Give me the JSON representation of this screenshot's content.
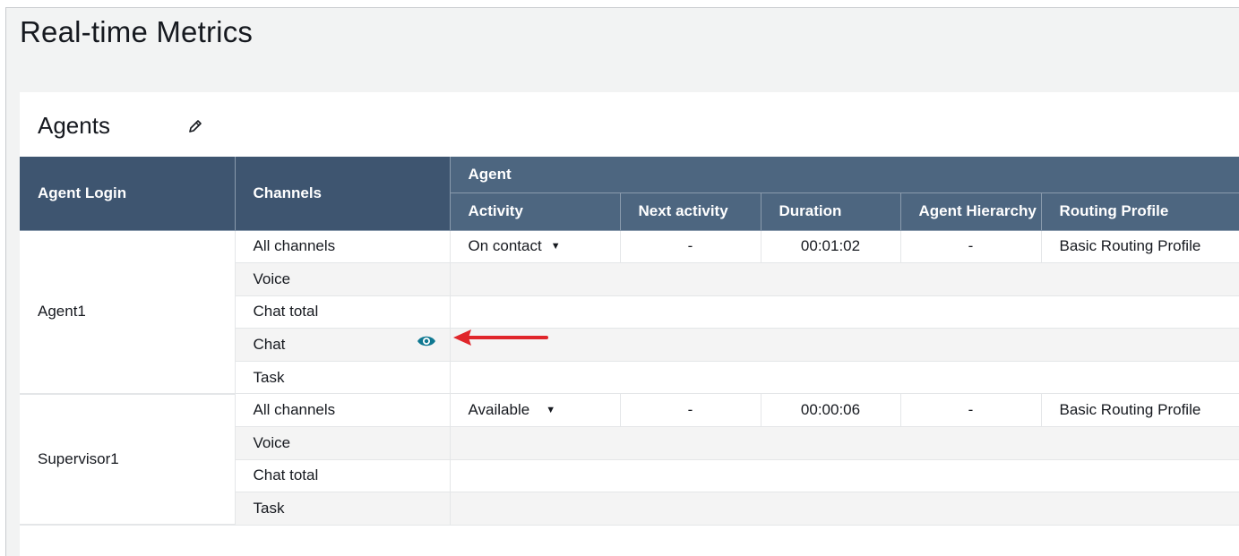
{
  "page": {
    "title": "Real-time Metrics"
  },
  "panel": {
    "title": "Agents",
    "edit_icon": "pencil-icon"
  },
  "columns": {
    "agent_login": "Agent Login",
    "channels": "Channels",
    "agent_group": "Agent",
    "activity": "Activity",
    "next_activity": "Next activity",
    "duration": "Duration",
    "agent_hierarchy": "Agent Hierarchy",
    "routing_profile": "Routing Profile"
  },
  "agents": [
    {
      "login": "Agent1",
      "channels": [
        "All channels",
        "Voice",
        "Chat total",
        "Chat",
        "Task"
      ],
      "activity": "On contact",
      "next_activity": "-",
      "duration": "00:01:02",
      "agent_hierarchy": "-",
      "routing_profile": "Basic Routing Profile"
    },
    {
      "login": "Supervisor1",
      "channels": [
        "All channels",
        "Voice",
        "Chat total",
        "Task"
      ],
      "activity": "Available",
      "next_activity": "-",
      "duration": "00:00:06",
      "agent_hierarchy": "-",
      "routing_profile": "Basic Routing Profile"
    }
  ],
  "icons": {
    "activity_dropdown": "caret-down-icon",
    "monitor": "eye-icon",
    "callout": "arrow-left-icon"
  },
  "colors": {
    "header_bg": "#4d6680",
    "header_bg_dark": "#3e5570",
    "eye": "#0f7891",
    "arrow": "#e0262b"
  }
}
